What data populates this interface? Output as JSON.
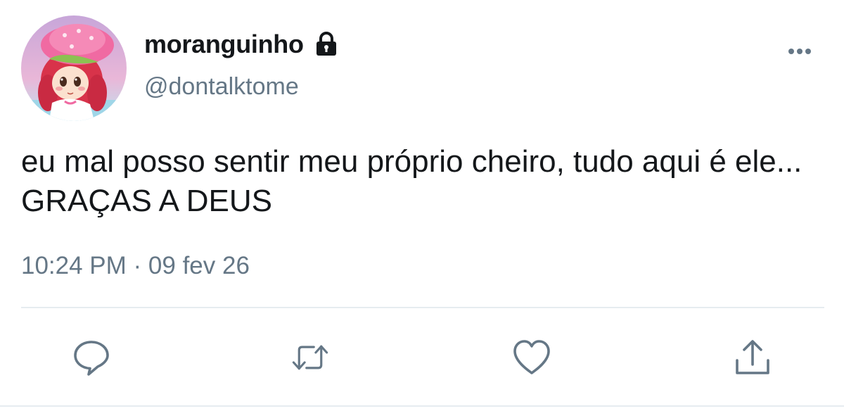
{
  "tweet": {
    "display_name": "moranguinho",
    "handle": "@dontalktome",
    "text": "eu mal posso sentir meu próprio cheiro, tudo aqui é ele... GRAÇAS A DEUS",
    "timestamp": "10:24 PM · 09 fev 26",
    "protected": true
  },
  "icons": {
    "avatar": "strawberry-character-avatar",
    "lock": "lock-icon",
    "more": "more-options-icon",
    "reply": "reply-icon",
    "retweet": "retweet-icon",
    "like": "heart-icon",
    "share": "share-icon"
  },
  "colors": {
    "text": "#14171a",
    "secondary": "#657786",
    "divider": "#e6ecf0",
    "action_icon": "#657786"
  }
}
